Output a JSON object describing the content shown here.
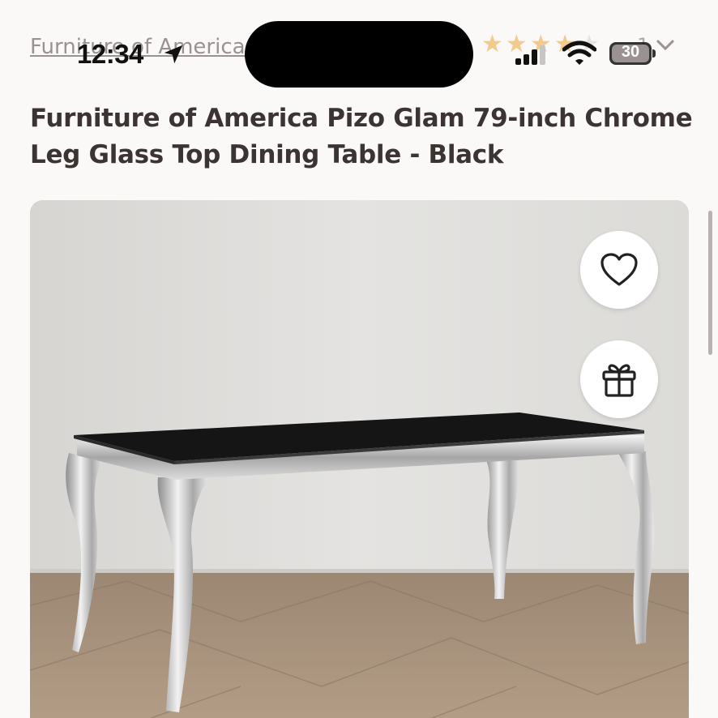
{
  "status_bar": {
    "time": "12:34",
    "battery": "30"
  },
  "breadcrumb": {
    "label": "Furniture of America"
  },
  "rating": {
    "stars_filled": 4,
    "stars_total": 5,
    "count": "1"
  },
  "product": {
    "title": "Furniture of America Pizo Glam 79-inch Chrome Leg Glass Top Dining Table - Black"
  },
  "colors": {
    "star": "#f4c98c",
    "background": "#fbf9f8"
  }
}
